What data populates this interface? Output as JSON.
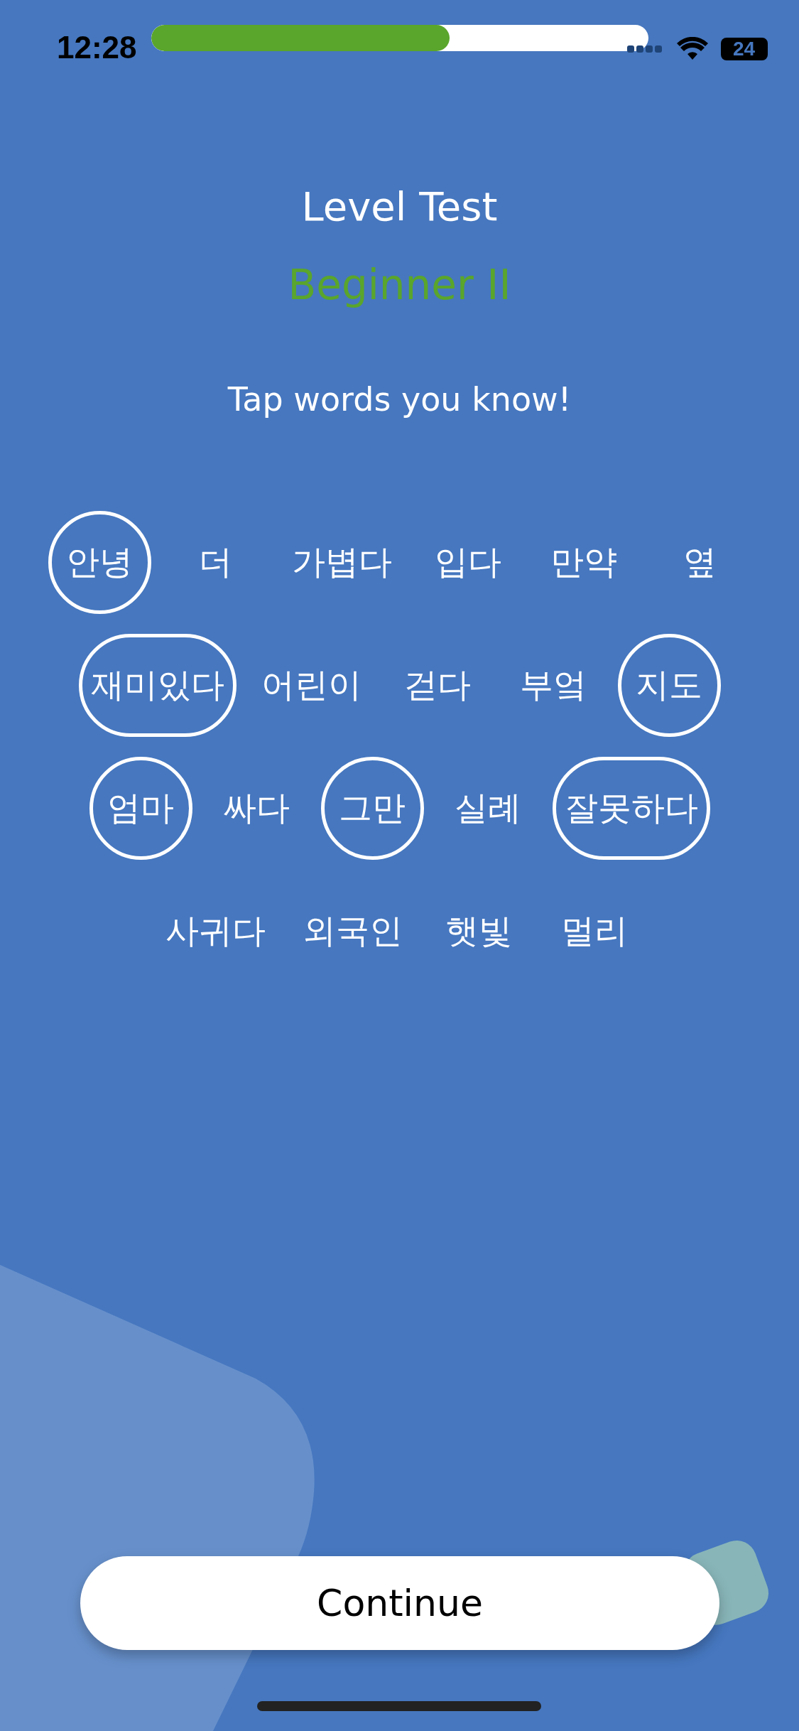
{
  "status_bar": {
    "time": "12:28",
    "battery": "24"
  },
  "progress": {
    "level": 0.6
  },
  "title": "Level Test",
  "level_name": "Beginner II",
  "instruction": "Tap words you know!",
  "word_rows": [
    [
      {
        "word": "안녕",
        "selected": true
      },
      {
        "word": "더",
        "selected": false
      },
      {
        "word": "가볍다",
        "selected": false
      },
      {
        "word": "입다",
        "selected": false
      },
      {
        "word": "만약",
        "selected": false
      },
      {
        "word": "옆",
        "selected": false
      }
    ],
    [
      {
        "word": "재미있다",
        "selected": true
      },
      {
        "word": "어린이",
        "selected": false
      },
      {
        "word": "걷다",
        "selected": false
      },
      {
        "word": "부엌",
        "selected": false
      },
      {
        "word": "지도",
        "selected": true
      }
    ],
    [
      {
        "word": "엄마",
        "selected": true
      },
      {
        "word": "싸다",
        "selected": false
      },
      {
        "word": "그만",
        "selected": true
      },
      {
        "word": "실례",
        "selected": false
      },
      {
        "word": "잘못하다",
        "selected": true
      }
    ],
    [
      {
        "word": "사귀다",
        "selected": false
      },
      {
        "word": "외국인",
        "selected": false
      },
      {
        "word": "햇빛",
        "selected": false
      },
      {
        "word": "멀리",
        "selected": false
      }
    ]
  ],
  "continue_button": "Continue"
}
